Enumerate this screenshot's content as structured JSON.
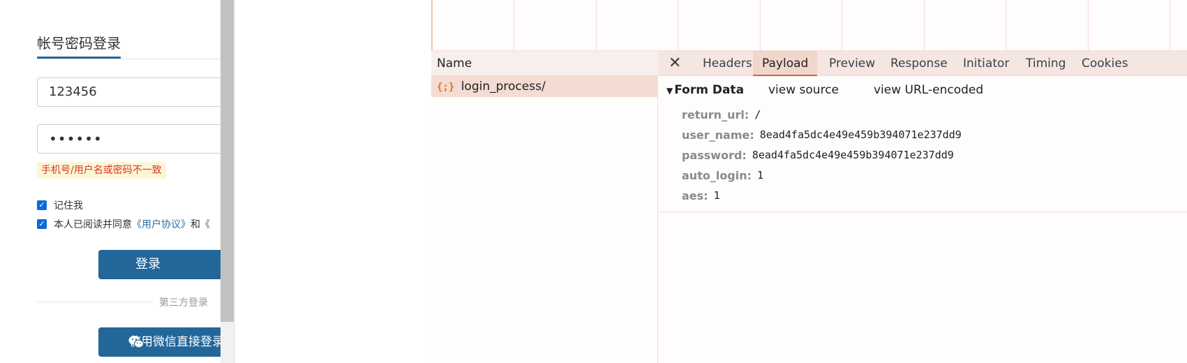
{
  "login": {
    "tab_label": "帐号密码登录",
    "username_value": "123456",
    "password_value": "••••••",
    "error_message": "手机号/用户名或密码不一致",
    "remember_label": "记住我",
    "agree_prefix": "本人已阅读并同意",
    "agree_link_1": "《用户协议》",
    "agree_and": "和",
    "agree_link_2": "《",
    "login_button": "登录",
    "third_party_label": "第三方登录",
    "wechat_button": "使用微信直接登录"
  },
  "devtools": {
    "name_header": "Name",
    "request_icon": "{;}",
    "request_name": "login_process/",
    "close_icon": "✕",
    "tabs": [
      "Headers",
      "Payload",
      "Preview",
      "Response",
      "Initiator",
      "Timing",
      "Cookies"
    ],
    "active_tab": "Payload",
    "payload": {
      "section_title": "Form Data",
      "view_source": "view source",
      "view_url_encoded": "view URL-encoded",
      "fields": [
        {
          "key": "return_url:",
          "value": "/"
        },
        {
          "key": "user_name:",
          "value": "8ead4fa5dc4e49e459b394071e237dd9"
        },
        {
          "key": "password:",
          "value": "8ead4fa5dc4e49e459b394071e237dd9"
        },
        {
          "key": "auto_login:",
          "value": "1"
        },
        {
          "key": "aes:",
          "value": "1"
        }
      ]
    }
  },
  "colors": {
    "brand_blue": "#23679a",
    "error_red": "#d9352c",
    "active_tab_underline": "#c8683d",
    "request_icon_orange": "#e8710a"
  }
}
